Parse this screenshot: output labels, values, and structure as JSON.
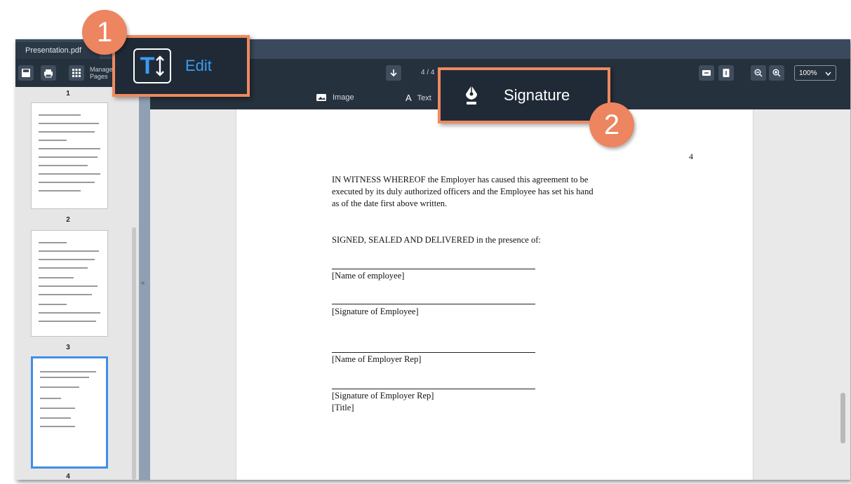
{
  "window": {
    "tab_title": "Presentation.pdf"
  },
  "toolbar": {
    "manage_pages_label": "Manage Pages",
    "page_indicator": "4 / 4",
    "zoom_level": "100%"
  },
  "subtoolbar": {
    "image_label": "Image",
    "text_label": "Text"
  },
  "sidebar": {
    "thumbnails": [
      {
        "number": "1"
      },
      {
        "number": "2"
      },
      {
        "number": "3"
      },
      {
        "number": "4"
      }
    ]
  },
  "document": {
    "page_number": "4",
    "paragraph_line_1": "IN WITNESS WHEREOF the Employer has caused this agreement to be",
    "paragraph_line_2": "executed by its duly authorized officers and the Employee has set his hand",
    "paragraph_line_3": "as of the date first above written.",
    "signed_line": "SIGNED, SEALED AND DELIVERED in the presence of:",
    "label_name_employee": "[Name of employee]",
    "label_signature_employee": "[Signature of Employee]",
    "label_name_employer_rep": "[Name of Employer Rep]",
    "label_signature_employer_rep": "[Signature of Employer Rep]",
    "label_title": "[Title]"
  },
  "callouts": {
    "edit": {
      "step": "1",
      "label": "Edit"
    },
    "signature": {
      "step": "2",
      "label": "Signature"
    }
  },
  "colors": {
    "accent": "#ef8a5f",
    "toolbar_bg": "#26313e",
    "selection": "#3f8fe8"
  }
}
